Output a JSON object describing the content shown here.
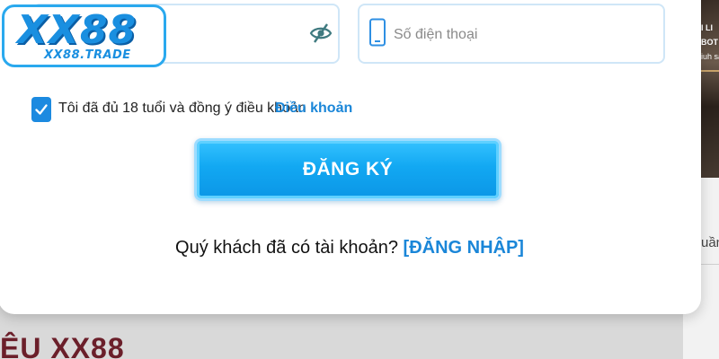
{
  "logo": {
    "main": "XX88",
    "domain": "XX88.TRADE"
  },
  "form": {
    "phone_placeholder": "Số điện thoại",
    "agree_text": "Tôi đã đủ 18 tuổi và đồng ý điều khoản",
    "terms_link": "Điều khoản",
    "register_label": "ĐĂNG KÝ",
    "login_question": "Quý khách đã có tài khoản?",
    "login_link": "[ĐĂNG NHẬP]",
    "agree_checked": true
  },
  "background": {
    "heading": "ỆU XX88",
    "side_lines": [
      "I LI",
      "BOT L",
      "iuh sa"
    ],
    "side_text": "uần"
  },
  "icons": {
    "password_toggle": "eye-slash-icon",
    "phone": "phone-icon",
    "checkbox": "checkmark-icon"
  },
  "colors": {
    "accent": "#1a86d8",
    "button": "#12a8f2",
    "field_border": "#cfe6f7"
  }
}
